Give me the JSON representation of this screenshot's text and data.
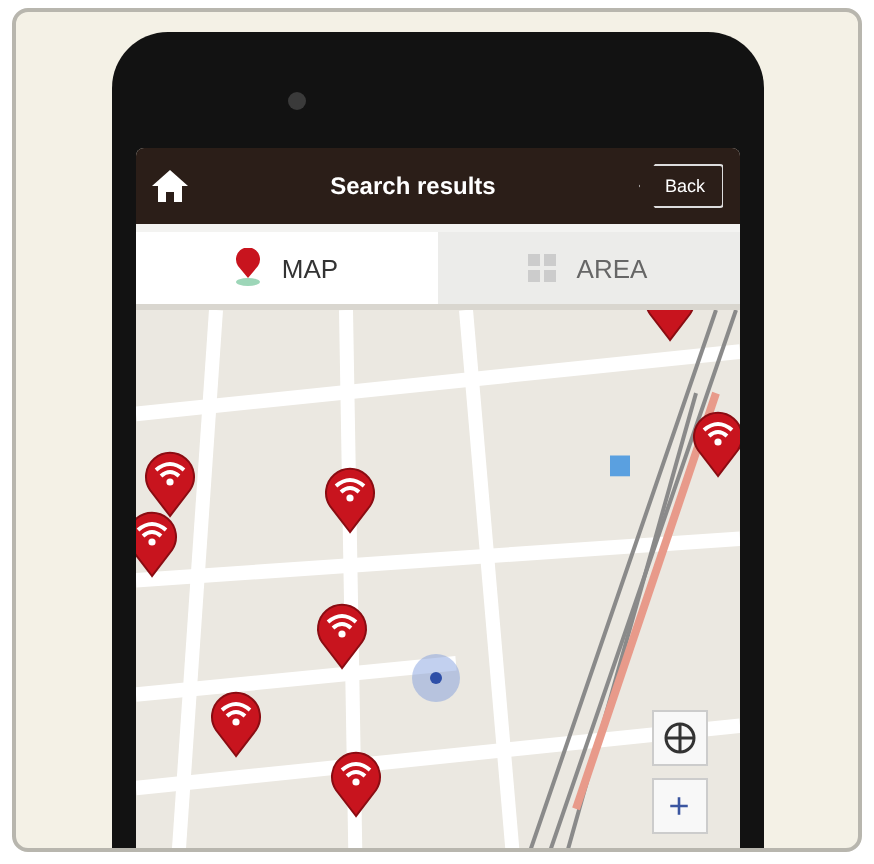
{
  "header": {
    "title": "Search results",
    "back_label": "Back"
  },
  "tabs": [
    {
      "label": "MAP",
      "kind": "map",
      "selected": true
    },
    {
      "label": "AREA",
      "kind": "area",
      "selected": false
    }
  ],
  "map": {
    "zoom_in_label": "+"
  }
}
